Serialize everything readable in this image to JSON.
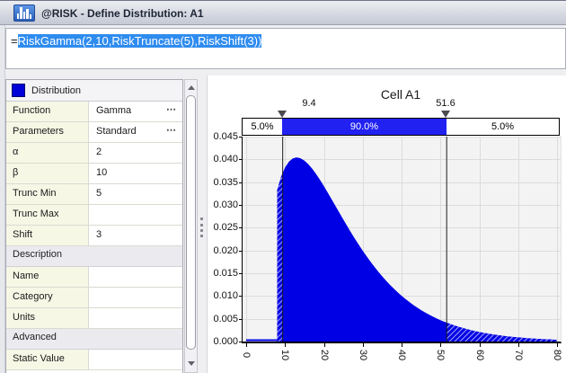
{
  "window": {
    "title": "@RISK - Define Distribution: A1"
  },
  "formula_bar": {
    "prefix": "=",
    "formula": "RiskGamma(2,10,RiskTruncate(5),RiskShift(3))"
  },
  "icons": {
    "ellipsis": "⋯"
  },
  "properties": {
    "header": {
      "label": "Distribution",
      "swatch_color": "#0000D8"
    },
    "rows": [
      {
        "label": "Function",
        "value": "Gamma",
        "ellipsis": true
      },
      {
        "label": "Parameters",
        "value": "Standard",
        "ellipsis": true
      },
      {
        "label": "α",
        "value": "2"
      },
      {
        "label": "β",
        "value": "10"
      },
      {
        "label": "Trunc Min",
        "value": "5"
      },
      {
        "label": "Trunc Max",
        "value": ""
      },
      {
        "label": "Shift",
        "value": "3"
      },
      {
        "section": "Description"
      },
      {
        "label": "Name",
        "value": ""
      },
      {
        "label": "Category",
        "value": ""
      },
      {
        "label": "Units",
        "value": ""
      },
      {
        "section": "Advanced"
      },
      {
        "label": "Static Value",
        "value": ""
      }
    ]
  },
  "chart_data": {
    "type": "area",
    "title": "Cell A1",
    "xlabel": "",
    "ylabel": "",
    "xlim": [
      -1,
      81
    ],
    "ylim": [
      0,
      0.045
    ],
    "grid": true,
    "x_ticks": [
      0,
      10,
      20,
      30,
      40,
      50,
      60,
      70,
      80
    ],
    "y_tick_labels": [
      "0.045",
      "0.040",
      "0.035",
      "0.030",
      "0.025",
      "0.020",
      "0.015",
      "0.010",
      "0.005",
      "0.000"
    ],
    "curve_color": "#0000E4",
    "band_color": "#2121F2",
    "hatch_line_color": "#A0A0FF",
    "distribution": {
      "function": "Gamma",
      "alpha": 2,
      "beta": 10,
      "trunc_min": 5,
      "shift": 3
    },
    "delimiters": {
      "left_x": 9.4,
      "right_x": 51.6,
      "left_label": "9.4",
      "right_label": "51.6",
      "bands": [
        "5.0%",
        "90.0%",
        "5.0%"
      ]
    },
    "baseline_segment": [
      [
        0,
        0
      ],
      [
        8,
        0
      ]
    ],
    "points": [
      [
        8,
        0.03333
      ],
      [
        9,
        0.03619
      ],
      [
        10,
        0.03821
      ],
      [
        11,
        0.03951
      ],
      [
        12,
        0.04022
      ],
      [
        13,
        0.04044
      ],
      [
        14,
        0.04025
      ],
      [
        15,
        0.03973
      ],
      [
        16,
        0.03894
      ],
      [
        17,
        0.03795
      ],
      [
        18,
        0.03679
      ],
      [
        19,
        0.03551
      ],
      [
        20,
        0.03414
      ],
      [
        21,
        0.0327
      ],
      [
        22,
        0.03124
      ],
      [
        23,
        0.02975
      ],
      [
        24,
        0.02827
      ],
      [
        25,
        0.02679
      ],
      [
        26,
        0.02535
      ],
      [
        27,
        0.02393
      ],
      [
        28,
        0.02256
      ],
      [
        29,
        0.02123
      ],
      [
        30,
        0.01994
      ],
      [
        31,
        0.01872
      ],
      [
        32,
        0.01754
      ],
      [
        33,
        0.01642
      ],
      [
        34,
        0.01535
      ],
      [
        35,
        0.01434
      ],
      [
        36,
        0.01338
      ],
      [
        37,
        0.01247
      ],
      [
        38,
        0.01162
      ],
      [
        39,
        0.01081
      ],
      [
        40,
        0.01005
      ],
      [
        41,
        0.00934
      ],
      [
        42,
        0.00868
      ],
      [
        43,
        0.00805
      ],
      [
        44,
        0.00747
      ],
      [
        45,
        0.00692
      ],
      [
        46,
        0.00641
      ],
      [
        47,
        0.00594
      ],
      [
        48,
        0.00549
      ],
      [
        49,
        0.00508
      ],
      [
        50,
        0.0047
      ],
      [
        51,
        0.00434
      ],
      [
        52,
        0.00401
      ],
      [
        53,
        0.0037
      ],
      [
        54,
        0.00342
      ],
      [
        55,
        0.00315
      ],
      [
        56,
        0.00291
      ],
      [
        57,
        0.00268
      ],
      [
        58,
        0.00247
      ],
      [
        59,
        0.00228
      ],
      [
        60,
        0.0021
      ],
      [
        61,
        0.00193
      ],
      [
        62,
        0.00178
      ],
      [
        63,
        0.00163
      ],
      [
        64,
        0.0015
      ],
      [
        65,
        0.00138
      ],
      [
        66,
        0.00127
      ],
      [
        67,
        0.00117
      ],
      [
        68,
        0.00107
      ],
      [
        69,
        0.00099
      ],
      [
        70,
        0.00091
      ],
      [
        71,
        0.00083
      ],
      [
        72,
        0.00076
      ],
      [
        73,
        0.0007
      ],
      [
        74,
        0.00064
      ],
      [
        75,
        0.00059
      ],
      [
        76,
        0.00054
      ],
      [
        77,
        0.0005
      ],
      [
        78,
        0.00046
      ],
      [
        79,
        0.00042
      ],
      [
        80,
        0.00038
      ]
    ]
  }
}
